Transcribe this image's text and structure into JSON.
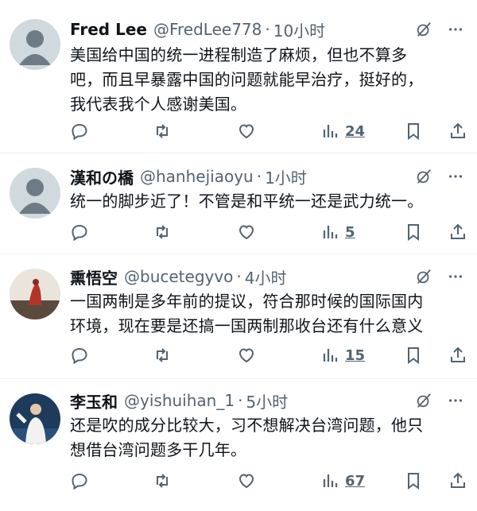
{
  "tweets": [
    {
      "name": "Fred Lee",
      "handle": "@FredLee778",
      "time": "10小时",
      "lines": [
        "美国给中国的统一进程制造了麻烦，但也不算多",
        "吧，而且早暴露中国的问题就能早治疗，挺好的，",
        "我代表我个人感谢美国。"
      ],
      "views": "24",
      "avatar": "default-avatar"
    },
    {
      "name": "漢和の橋",
      "handle": "@hanhejiaoyu",
      "time": "1小时",
      "lines": [
        "统一的脚步近了！不管是和平统一还是武力统一。"
      ],
      "views": "5",
      "avatar": "default-avatar"
    },
    {
      "name": "熏悟空",
      "handle": "@bucetegyvo",
      "time": "4小时",
      "lines": [
        "一国两制是多年前的提议，符合那时候的国际国内",
        "环境，现在要是还搞一国两制那收台还有什么意义"
      ],
      "views": "15",
      "avatar": "photo-avatar-red-figure"
    },
    {
      "name": "李玉和",
      "handle": "@yishuihan_1",
      "time": "5小时",
      "lines": [
        "还是吹的成分比较大，习不想解决台湾问题，他只",
        "想借台湾问题多干几年。"
      ],
      "views": "67",
      "avatar": "photo-avatar-person"
    }
  ],
  "separator": "·",
  "colors": {
    "text": "#0f1419",
    "secondary": "#536471",
    "border": "#eff3f4"
  }
}
